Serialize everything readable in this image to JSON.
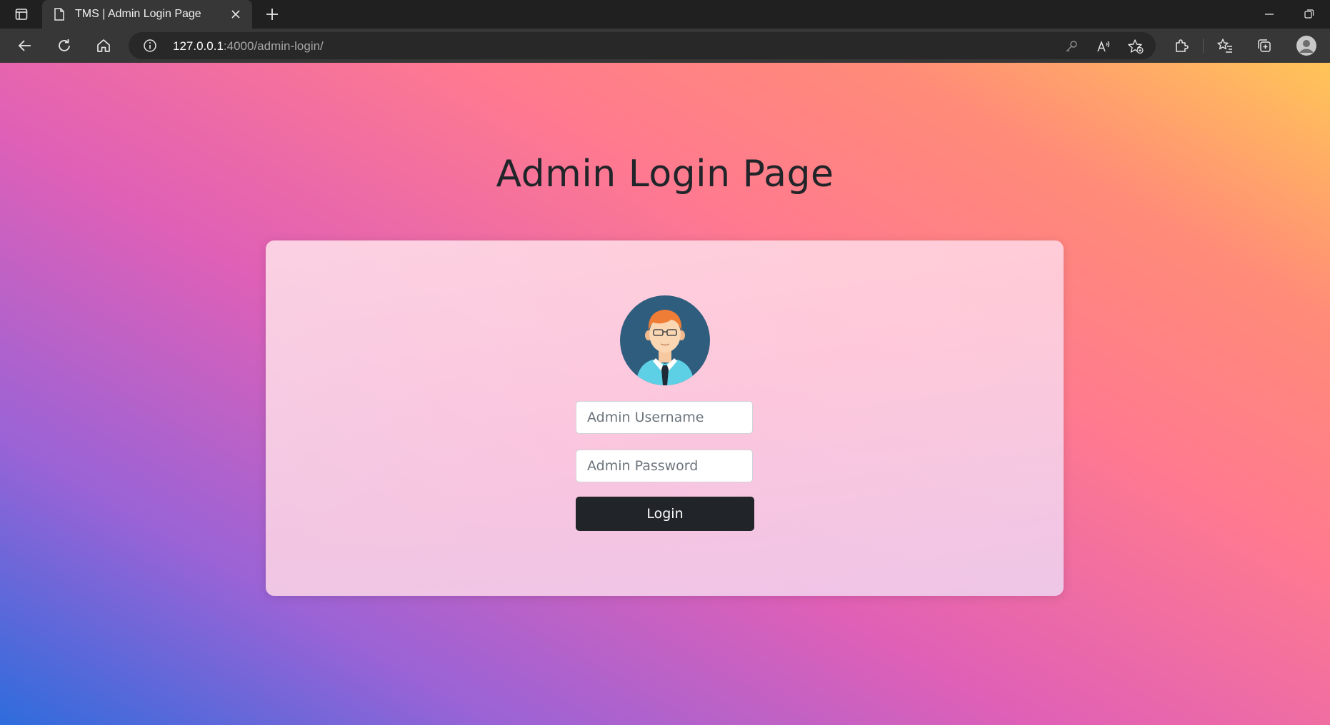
{
  "browser": {
    "tab_title": "TMS | Admin Login Page",
    "url_host": "127.0.0.1",
    "url_rest": ":4000/admin-login/"
  },
  "page": {
    "title": "Admin Login Page",
    "username_placeholder": "Admin Username",
    "password_placeholder": "Admin Password",
    "login_label": "Login"
  },
  "colors": {
    "accent_button": "#212529",
    "gradient": [
      "#2e6cdc",
      "#9a63d6",
      "#e060b6",
      "#ff7a8f",
      "#ffc558"
    ]
  },
  "icons": {
    "avatar": "admin-avatar-icon"
  }
}
